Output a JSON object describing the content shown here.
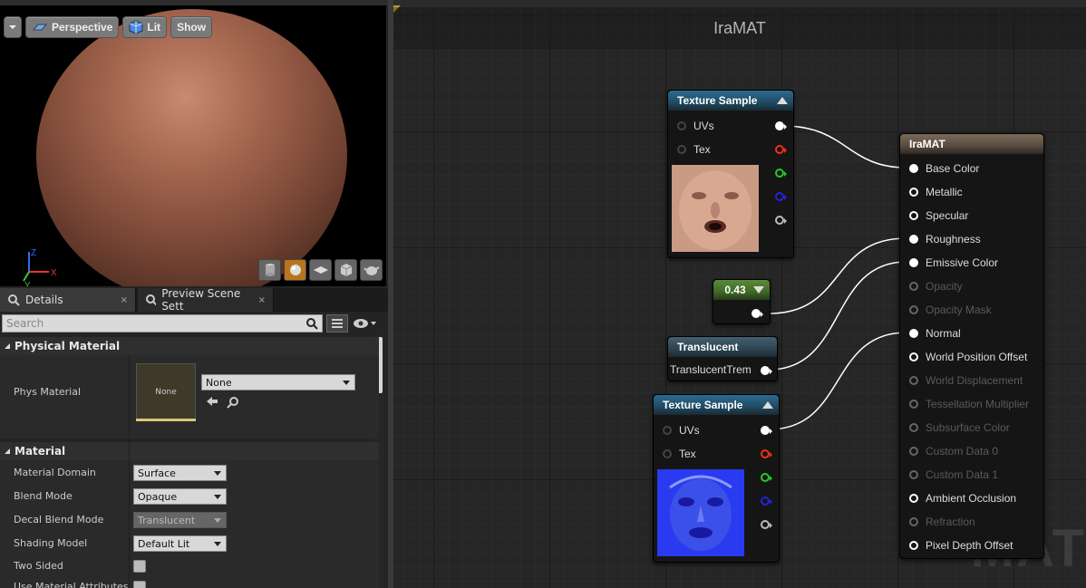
{
  "viewport": {
    "perspective_label": "Perspective",
    "lit_label": "Lit",
    "show_label": "Show",
    "axis": {
      "z": "Z",
      "y": "Y",
      "x": "X"
    }
  },
  "tabs": [
    {
      "label": "Details",
      "close": "×"
    },
    {
      "label": "Preview Scene Sett",
      "close": "×"
    }
  ],
  "search": {
    "placeholder": "Search"
  },
  "physical_material": {
    "header": "Physical Material",
    "label": "Phys Material",
    "thumb_text": "None",
    "value": "None"
  },
  "material": {
    "header": "Material",
    "rows": [
      {
        "label": "Material Domain",
        "value": "Surface"
      },
      {
        "label": "Blend Mode",
        "value": "Opaque"
      },
      {
        "label": "Decal Blend Mode",
        "value": "Translucent"
      },
      {
        "label": "Shading Model",
        "value": "Default Lit"
      },
      {
        "label": "Two Sided"
      },
      {
        "label": "Use Material Attributes"
      }
    ]
  },
  "graph": {
    "title": "IraMAT",
    "watermark": "MAT",
    "texture_sample_1": {
      "title": "Texture Sample",
      "inputs": [
        "UVs",
        "Tex"
      ]
    },
    "texture_sample_2": {
      "title": "Texture Sample",
      "inputs": [
        "UVs",
        "Tex"
      ]
    },
    "constant": {
      "value": "0.43"
    },
    "translucent": {
      "title": "Translucent",
      "output": "TranslucentTrem"
    },
    "result": {
      "title": "IraMAT",
      "inputs": [
        "Base Color",
        "Metallic",
        "Specular",
        "Roughness",
        "Emissive Color",
        "Opacity",
        "Opacity Mask",
        "Normal",
        "World Position Offset",
        "World Displacement",
        "Tessellation Multiplier",
        "Subsurface Color",
        "Custom Data 0",
        "Custom Data 1",
        "Ambient Occlusion",
        "Refraction",
        "Pixel Depth Offset"
      ]
    }
  },
  "colors": {
    "accent_orange": "#b8751a",
    "node_header_blue": "#2e6b8e",
    "constant_green": "#5a8a3a"
  }
}
